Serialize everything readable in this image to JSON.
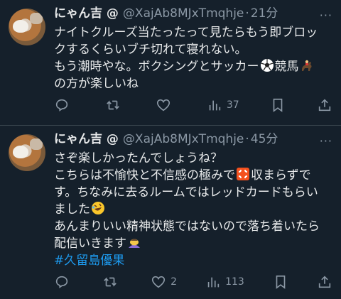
{
  "colors": {
    "background": "#15202b",
    "text": "#e7e9ea",
    "muted": "#8b98a5",
    "link": "#1d9bf0",
    "divider": "#38444d"
  },
  "tweets": [
    {
      "name": "にゃん吉 @",
      "handle": "@XajAb8MJxTmqhje",
      "dot": "·",
      "time": "21分",
      "more": "···",
      "lines": [
        "ナイトクルーズ当たったって見たらもう即ブロッ",
        "クするくらいブチ切れて寝れない。",
        "もう潮時やな。ボクシングとサッカー",
        "競馬",
        "の方が楽しいね"
      ],
      "emojis": [
        "soccer-ball-emoji",
        "horse-racing-emoji"
      ],
      "stats": {
        "reply": "",
        "retweet": "",
        "like": "",
        "views": "37"
      }
    },
    {
      "name": "にゃん吉 @",
      "handle": "@XajAb8MJxTmqhje",
      "dot": "·",
      "time": "45分",
      "more": "···",
      "lines": [
        "さぞ楽しかったんでしょうね？",
        "こちらは不愉快と不信感の極みで",
        "収まらずで",
        "す。ちなみに去るルームではレッドカードもらい",
        "ました",
        "あんまりいい精神状態ではないので落ち着いたら",
        "配信いきます",
        "#久留島優果"
      ],
      "emojis": [
        "anger-symbol-emoji",
        "rofl-emoji",
        "bowing-person-emoji"
      ],
      "stats": {
        "reply": "",
        "retweet": "",
        "like": "2",
        "views": "113"
      }
    }
  ]
}
